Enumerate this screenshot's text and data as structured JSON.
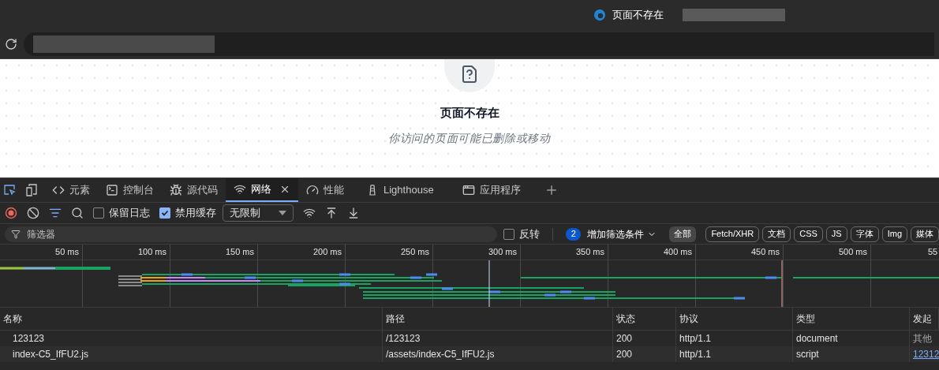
{
  "window": {
    "title": "页面不存在"
  },
  "page": {
    "heading": "页面不存在",
    "message": "你访问的页面可能已删除或移动"
  },
  "devtools": {
    "tabs": [
      {
        "kind": "code",
        "label": "元素",
        "selected": false
      },
      {
        "kind": "console",
        "label": "控制台",
        "selected": false
      },
      {
        "kind": "bug",
        "label": "源代码",
        "selected": false
      },
      {
        "kind": "wifi",
        "label": "网络",
        "selected": true
      },
      {
        "kind": "gauge",
        "label": "性能",
        "selected": false
      },
      {
        "kind": "lighthouse",
        "label": "Lighthouse",
        "selected": false
      },
      {
        "kind": "app",
        "label": "应用程序",
        "selected": false
      }
    ],
    "toolbar": {
      "preserve_log": {
        "label": "保留日志",
        "checked": false
      },
      "disable_cache": {
        "label": "禁用缓存",
        "checked": true
      },
      "throttling": "无限制"
    },
    "filter": {
      "placeholder": "筛选器",
      "invert": {
        "label": "反转",
        "checked": false
      },
      "filter_count": "2",
      "more_filters": "增加筛选条件",
      "types": [
        {
          "label": "全部",
          "selected": true
        },
        {
          "label": "Fetch/XHR",
          "selected": false
        },
        {
          "label": "文档",
          "selected": false
        },
        {
          "label": "CSS",
          "selected": false
        },
        {
          "label": "JS",
          "selected": false
        },
        {
          "label": "字体",
          "selected": false
        },
        {
          "label": "Img",
          "selected": false
        },
        {
          "label": "媒体",
          "selected": false
        }
      ]
    },
    "timeline": {
      "ticks": [
        "50 ms",
        "100 ms",
        "150 ms",
        "200 ms",
        "250 ms",
        "300 ms",
        "350 ms",
        "400 ms",
        "450 ms",
        "500 ms",
        "55"
      ]
    },
    "table": {
      "columns": [
        "名称",
        "路径",
        "状态",
        "协议",
        "类型",
        "发起"
      ],
      "rows": [
        {
          "name": "123123",
          "path": "/123123",
          "status": "200",
          "protocol": "http/1.1",
          "type": "document",
          "initiator": "其他",
          "initiator_link": false
        },
        {
          "name": "index-C5_IfFU2.js",
          "path": "/assets/index-C5_IfFU2.js",
          "status": "200",
          "protocol": "http/1.1",
          "type": "script",
          "initiator": "12312",
          "initiator_link": true
        }
      ]
    }
  }
}
